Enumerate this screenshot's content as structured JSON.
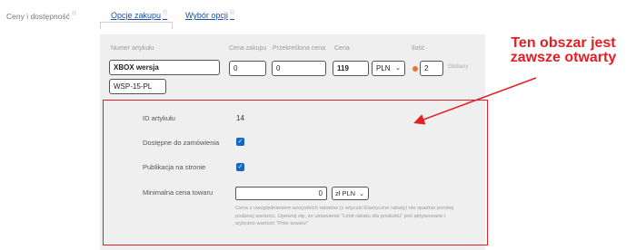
{
  "section": {
    "label": "Ceny i dostępność",
    "help": "®"
  },
  "tabs": [
    {
      "label": "Opcje zakupu",
      "help": "®"
    },
    {
      "label": "Wybór opcji",
      "help": "®"
    }
  ],
  "headers": {
    "item_number": "Numer artykułu",
    "purchase_price": "Cena zakupu",
    "strikethrough_price": "Przekreślona cena",
    "price": "Cena",
    "quantity": "Ilość"
  },
  "fields": {
    "item_number": "XBOX wersja",
    "sku": "WSP-15-PL",
    "purchase_price": "0",
    "strikethrough_price": "0",
    "price": "119",
    "currency": "PLN",
    "quantity": "2",
    "quantity_unit": "Globany"
  },
  "details": {
    "id_label": "ID artykułu",
    "id_value": "14",
    "available_label": "Dostępne do zamówienia",
    "published_label": "Publikacja na stronie",
    "min_price_label": "Minimalna cena towaru",
    "min_price_value": "0",
    "min_price_currency": "zł PLN",
    "note": "Cena z uwzględnieniem wszystkich rabatów (z wtyczki Elastyczne rabaty) nie spadnie poniżej podanej wartości. Upewnij się, że ustawienie \"Limit rabatu dla produktu\" jest aktywowane i wybrano wartość \"Pole towaru\""
  },
  "annotation": {
    "text": "Ten obszar jest zawsze otwarty",
    "color": "#e31e24"
  },
  "colors": {
    "accent": "#1766c3",
    "link": "#1a4fa8",
    "status_dot": "#e8743b"
  }
}
